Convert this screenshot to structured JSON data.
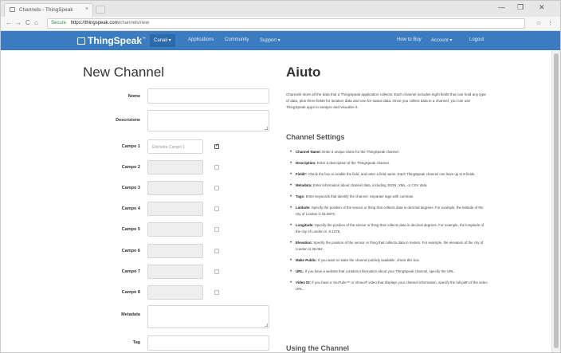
{
  "browser": {
    "tab_title": "Channels - ThingSpeak",
    "tab_close": "×",
    "window_controls": [
      "—",
      "❐",
      "✕"
    ],
    "nav": {
      "back": "←",
      "forward": "→",
      "reload": "C",
      "home": "⌂"
    },
    "url_secure": "Secure",
    "url_domain": "https://thingspeak.com",
    "url_path": "/channels/new",
    "extensions": "☆ ⋮"
  },
  "navbar": {
    "brand": "ThingSpeak",
    "brand_tm": "™",
    "items": [
      {
        "label": "Canali ▾",
        "active": true
      },
      {
        "label": "Applications",
        "active": false
      },
      {
        "label": "Community",
        "active": false
      },
      {
        "label": "Support ▾",
        "active": false
      }
    ],
    "right_items": [
      "How to Buy",
      "Account ▾",
      "Logout"
    ]
  },
  "form": {
    "title": "New Channel",
    "fields": [
      {
        "label": "Nome",
        "type": "text",
        "value": "",
        "placeholder": ""
      },
      {
        "label": "Descrizione",
        "type": "textarea",
        "value": "",
        "placeholder": ""
      },
      {
        "label": "Campo 1",
        "type": "text",
        "value": "",
        "placeholder": "Etichetta Campo 1",
        "checked": true
      },
      {
        "label": "Campo 2",
        "type": "text",
        "value": "",
        "placeholder": "",
        "checked": false
      },
      {
        "label": "Campo 3",
        "type": "text",
        "value": "",
        "placeholder": "",
        "checked": false
      },
      {
        "label": "Campo 4",
        "type": "text",
        "value": "",
        "placeholder": "",
        "checked": false
      },
      {
        "label": "Campo 5",
        "type": "text",
        "value": "",
        "placeholder": "",
        "checked": false
      },
      {
        "label": "Campo 6",
        "type": "text",
        "value": "",
        "placeholder": "",
        "checked": false
      },
      {
        "label": "Campo 7",
        "type": "text",
        "value": "",
        "placeholder": "",
        "checked": false
      },
      {
        "label": "Campo 8",
        "type": "text",
        "value": "",
        "placeholder": "",
        "checked": false
      },
      {
        "label": "Metadata",
        "type": "textarea",
        "value": "",
        "placeholder": ""
      },
      {
        "label": "Tag",
        "type": "text",
        "value": "",
        "placeholder": ""
      }
    ]
  },
  "help": {
    "title": "Aiuto",
    "intro": "Channels store all the data that a ThingSpeak application collects. Each channel includes eight fields that can hold any type of data, plus three fields for location data and one for status data. Once you collect data in a channel, you can use ThingSpeak apps to analyze and visualize it.",
    "settings_title": "Channel Settings",
    "settings": [
      {
        "term": "Channel Name:",
        "text": "Enter a unique name for the ThingSpeak channel."
      },
      {
        "term": "Description:",
        "text": "Enter a description of the ThingSpeak channel."
      },
      {
        "term": "Field#:",
        "text": "Check the box to enable the field, and enter a field name. Each ThingSpeak channel can have up to 8 fields."
      },
      {
        "term": "Metadata:",
        "text": "Enter information about channel data, including JSON, XML, or CSV data."
      },
      {
        "term": "Tags:",
        "text": "Enter keywords that identify the channel. Separate tags with commas."
      },
      {
        "term": "Latitude:",
        "text": "Specify the position of the sensor or thing that collects data in decimal degrees. For example, the latitude of the city of London is 51.5072."
      },
      {
        "term": "Longitude:",
        "text": "Specify the position of the sensor or thing that collects data in decimal degrees. For example, the longitude of the city of London is -0.1275."
      },
      {
        "term": "Elevation:",
        "text": "Specify the position of the sensor or thing that collects data in meters. For example, the elevation of the city of London is 35.052."
      },
      {
        "term": "Make Public:",
        "text": "If you want to make the channel publicly available, check this box."
      },
      {
        "term": "URL:",
        "text": "If you have a website that contains information about your ThingSpeak channel, specify the URL."
      },
      {
        "term": "Video ID:",
        "text": "If you have a YouTube™ or Vimeo® video that displays your channel information, specify the full path of the video URL."
      }
    ],
    "using_title": "Using the Channel"
  }
}
